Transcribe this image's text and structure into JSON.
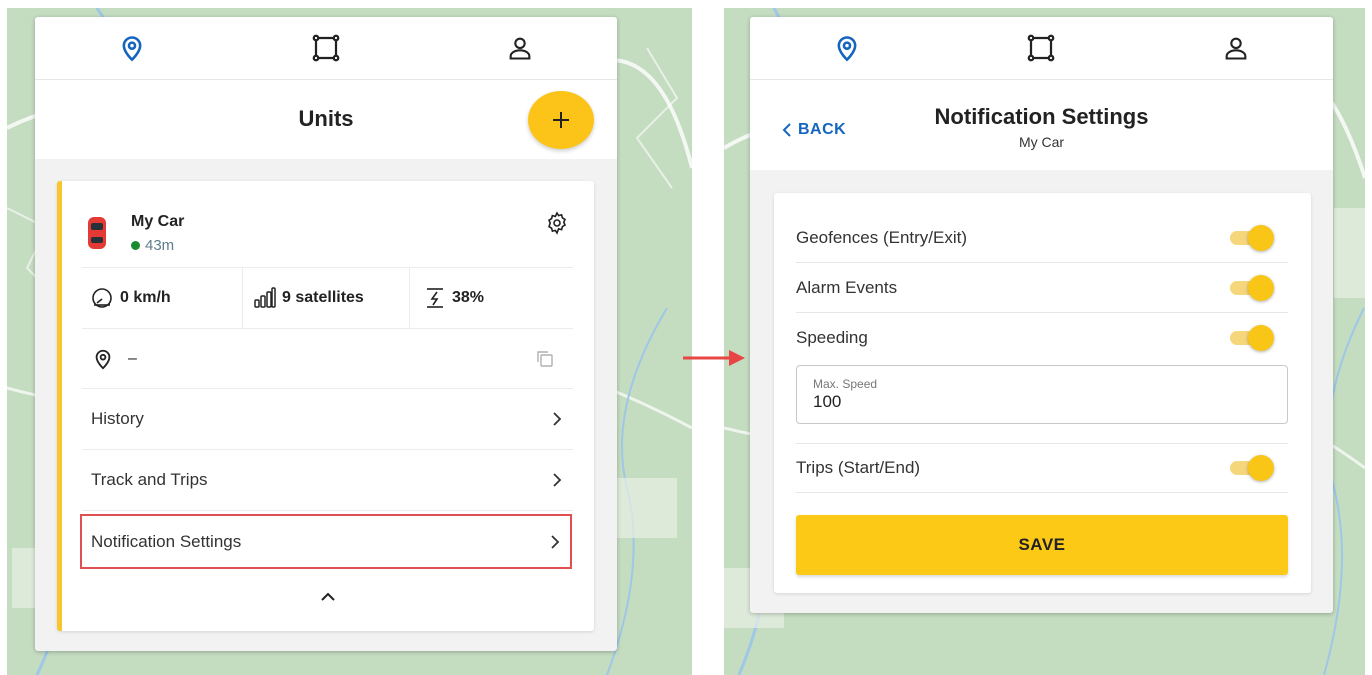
{
  "colors": {
    "accent_yellow": "#fcc419",
    "link_blue": "#1565c0",
    "online_green": "#188a2f",
    "highlight_red": "#e05050",
    "map_green": "#c4dcc0"
  },
  "nav": {
    "icons": [
      "map-marker-icon",
      "geofence-square-icon",
      "user-icon"
    ]
  },
  "units_panel": {
    "title": "Units",
    "add_button_label": "+",
    "unit": {
      "name": "My Car",
      "status_time": "43m",
      "speed": "0 km/h",
      "satellites": "9 satellites",
      "battery": "38%",
      "address": "–"
    },
    "menu": [
      {
        "label": "History"
      },
      {
        "label": "Track and Trips"
      },
      {
        "label": "Notification Settings"
      }
    ]
  },
  "notification_panel": {
    "back_label": "BACK",
    "title": "Notification Settings",
    "subtitle": "My Car",
    "settings": [
      {
        "label": "Geofences (Entry/Exit)",
        "enabled": true
      },
      {
        "label": "Alarm Events",
        "enabled": true
      },
      {
        "label": "Speeding",
        "enabled": true
      },
      {
        "label": "Trips (Start/End)",
        "enabled": true
      }
    ],
    "max_speed": {
      "label": "Max. Speed",
      "value": "100"
    },
    "save_label": "SAVE"
  }
}
